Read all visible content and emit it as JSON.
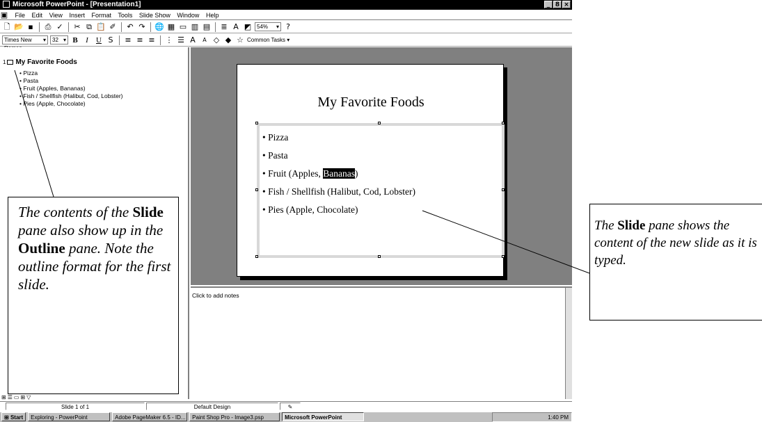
{
  "window": {
    "title": "Microsoft PowerPoint - [Presentation1]",
    "controls": [
      "_",
      "8",
      "×"
    ]
  },
  "menu": [
    "File",
    "Edit",
    "View",
    "Insert",
    "Format",
    "Tools",
    "Slide Show",
    "Window",
    "Help"
  ],
  "toolbar": {
    "zoom": "54%",
    "font_name": "Times New Roman",
    "font_size": "32",
    "common_tasks": "Common Tasks"
  },
  "outline": {
    "slide_number": "1",
    "title": "My Favorite Foods",
    "bullets": [
      "Pizza",
      "Pasta",
      "Fruit (Apples, Bananas)",
      "Fish / Shellfish (Halibut, Cod, Lobster)",
      "Pies (Apple, Chocolate)"
    ]
  },
  "slide": {
    "title": "My Favorite Foods",
    "bullets": [
      "Pizza",
      "Pasta",
      "Fruit (Apples, ",
      "Fish / Shellfish (Halibut, Cod, Lobster)",
      "Pies (Apple, Chocolate)"
    ],
    "highlighted": "Bananas",
    "after_highlight": ")"
  },
  "notes": {
    "placeholder": "Click to add notes"
  },
  "status": {
    "slide": "Slide 1 of 1",
    "design": "Default Design"
  },
  "taskbar": {
    "start": "Start",
    "tasks": [
      "Exploring - PowerPoint",
      "Adobe PageMaker 6.5 - ID...",
      "Paint Shop Pro - Image3.psp",
      "Microsoft PowerPoint"
    ],
    "time": "1:40 PM"
  },
  "callouts": {
    "outline": {
      "part1": "The contents of the ",
      "bold1": "Slide",
      "part2": " pane also show up in the ",
      "bold2": "Outline",
      "part3": " pane. Note the outline format for the first slide."
    },
    "slide": {
      "part1": "The ",
      "bold1": "Slide",
      "part2": " pane shows the content of the new slide as it is typed."
    }
  }
}
